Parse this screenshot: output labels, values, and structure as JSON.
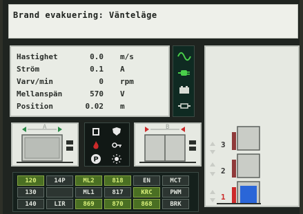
{
  "header": {
    "title": "Brand evakuering: Vänteläge"
  },
  "readings": [
    {
      "label": "Hastighet",
      "value": "0.0",
      "unit": "m/s"
    },
    {
      "label": "Ström",
      "value": "0.1",
      "unit": "A"
    },
    {
      "label": "Varv/min",
      "value": "0",
      "unit": "rpm"
    },
    {
      "label": "Mellanspän",
      "value": "570",
      "unit": "V"
    },
    {
      "label": "Position",
      "value": "0.02",
      "unit": "m"
    }
  ],
  "status_icons": [
    "sine-wave-icon",
    "plug-icon",
    "battery-icon",
    "connector-icon"
  ],
  "doors": {
    "left": {
      "label": "A"
    },
    "right": {
      "label": "B"
    }
  },
  "mid_icons": [
    "door-icon",
    "shield-icon",
    "fire-icon",
    "key-icon",
    "parking-icon",
    "light-icon"
  ],
  "floors": [
    {
      "number": "3",
      "color": "#333333"
    },
    {
      "number": "2",
      "color": "#333333"
    },
    {
      "number": "1",
      "color": "#cc2a2a"
    }
  ],
  "grid": {
    "rows": [
      [
        "120",
        "14P",
        "ML2",
        "818",
        "EN",
        "MCT"
      ],
      [
        "130",
        "",
        "ML1",
        "817",
        "KRC",
        "PWM"
      ],
      [
        "140",
        "LIR",
        "869",
        "870",
        "868",
        "BRK"
      ]
    ],
    "highlight": [
      [
        "green",
        "dark",
        "green",
        "green",
        "dark",
        "dark"
      ],
      [
        "dark",
        "dark",
        "dark",
        "dark",
        "green",
        "dark"
      ],
      [
        "dark",
        "dark",
        "green",
        "green",
        "green",
        "dark"
      ]
    ]
  },
  "colors": {
    "screen_bg": "#1f2420",
    "panel_bg": "#e6e9e2",
    "accent_green": "#4ad04a",
    "alarm_red": "#cc2a2a",
    "car_blue": "#2a66d8"
  }
}
